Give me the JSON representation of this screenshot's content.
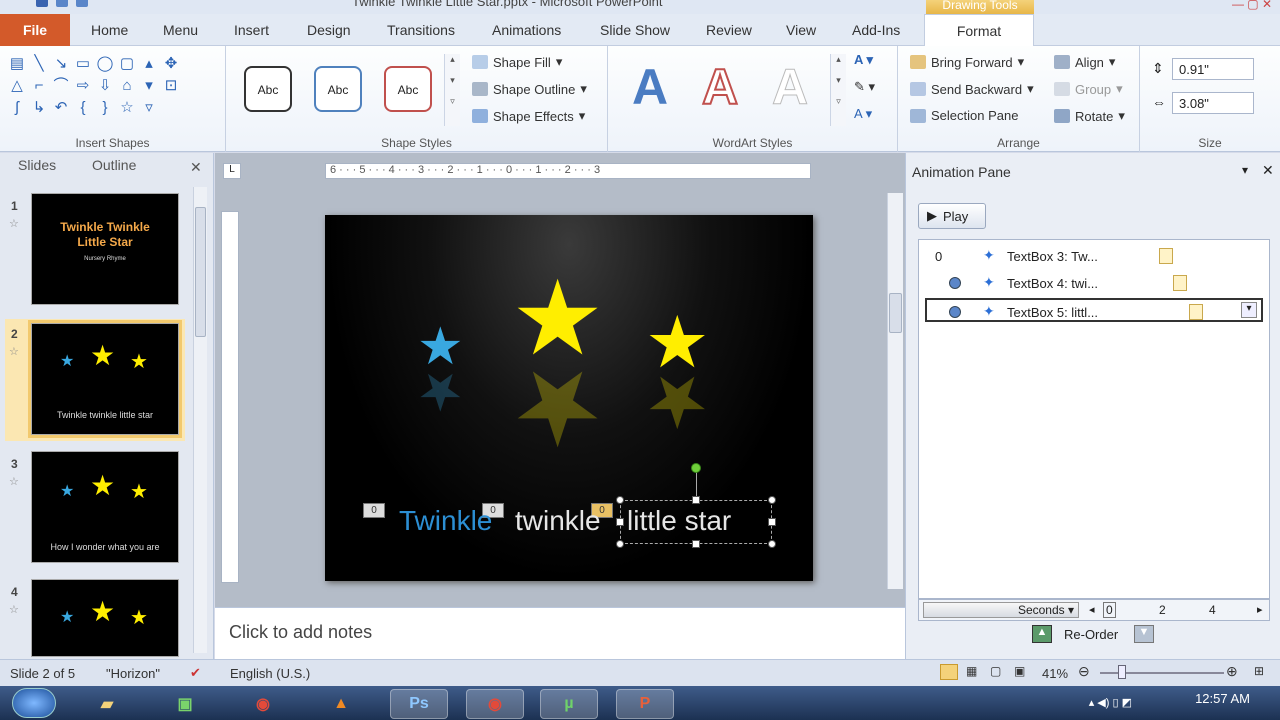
{
  "window": {
    "title": "Twinkle Twinkle Little Star.pptx - Microsoft PowerPoint",
    "context_tab_group": "Drawing Tools"
  },
  "ribbon_tabs": [
    "File",
    "Home",
    "Menu",
    "Insert",
    "Design",
    "Transitions",
    "Animations",
    "Slide Show",
    "Review",
    "View",
    "Add-Ins",
    "Format"
  ],
  "ribbon": {
    "insert_shapes": {
      "label": "Insert Shapes"
    },
    "shape_styles": {
      "label": "Shape Styles",
      "sample": "Abc",
      "fill": "Shape Fill",
      "outline": "Shape Outline",
      "effects": "Shape Effects"
    },
    "wordart": {
      "label": "WordArt Styles",
      "letter": "A"
    },
    "arrange": {
      "label": "Arrange",
      "bring_forward": "Bring Forward",
      "send_backward": "Send Backward",
      "selection_pane": "Selection Pane",
      "align": "Align",
      "group": "Group",
      "rotate": "Rotate"
    },
    "size": {
      "label": "Size",
      "height": "0.91\"",
      "width": "3.08\""
    }
  },
  "slides_panel": {
    "tab_slides": "Slides",
    "tab_outline": "Outline",
    "thumbs": [
      {
        "num": "1",
        "title": "Twinkle Twinkle Little Star",
        "subtitle": "Nursery Rhyme"
      },
      {
        "num": "2",
        "text": "Twinkle twinkle little star"
      },
      {
        "num": "3",
        "text": "How I wonder what you are"
      },
      {
        "num": "4"
      }
    ]
  },
  "slide": {
    "word1": "Twinkle",
    "word2": "twinkle",
    "word3": "little star",
    "tag1": "0",
    "tag2": "0",
    "tag3": "0"
  },
  "ruler": {
    "ticks": "6 · · · 5 · · · 4 · · · 3 · · · 2 · · · 1 · · · 0 · · · 1 · · · 2 · · · 3"
  },
  "notes": {
    "placeholder": "Click to add notes"
  },
  "animation_pane": {
    "title": "Animation Pane",
    "play": "Play",
    "items": [
      {
        "order": "0",
        "label": "TextBox 3: Tw..."
      },
      {
        "order": "",
        "label": "TextBox 4: twi..."
      },
      {
        "order": "",
        "label": "TextBox 5: littl..."
      }
    ],
    "seconds": "Seconds",
    "timeline": [
      "0",
      "2",
      "4"
    ],
    "reorder": "Re-Order"
  },
  "status": {
    "slide": "Slide 2 of 5",
    "theme": "\"Horizon\"",
    "language": "English (U.S.)",
    "zoom": "41%"
  },
  "taskbar": {
    "time": "12:57 AM",
    "apps": [
      "Windows Explorer",
      "Camtasia",
      "Chrome",
      "VLC",
      "Photoshop",
      "Chrome",
      "uTorrent",
      "PowerPoint"
    ]
  },
  "colors": {
    "accent": "#d35a2a",
    "star_yellow": "#ffee00",
    "star_blue": "#39a8e0",
    "context_tab": "#e7b648"
  }
}
